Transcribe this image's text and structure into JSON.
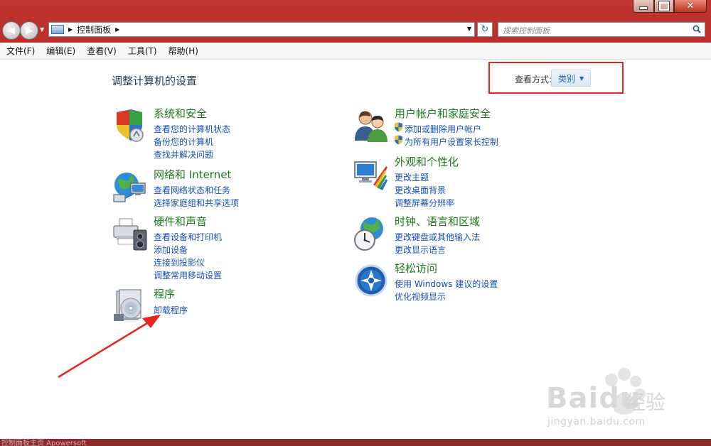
{
  "window": {
    "title_bar_buttons": [
      "minimize-icon",
      "maximize-icon",
      "close-icon"
    ]
  },
  "address": {
    "breadcrumb": "控制面板",
    "search_placeholder": "搜索控制面板"
  },
  "menu": [
    "文件(F)",
    "编辑(E)",
    "查看(V)",
    "工具(T)",
    "帮助(H)"
  ],
  "page": {
    "heading": "调整计算机的设置",
    "view_by_label": "查看方式:",
    "view_by_value": "类别"
  },
  "categories": [
    {
      "title": "系统和安全",
      "icon": "shield-icon",
      "links": [
        "查看您的计算机状态",
        "备份您的计算机",
        "查找并解决问题"
      ]
    },
    {
      "title": "网络和 Internet",
      "icon": "globe-network-icon",
      "links": [
        "查看网络状态和任务",
        "选择家庭组和共享选项"
      ]
    },
    {
      "title": "硬件和声音",
      "icon": "printer-speaker-icon",
      "links": [
        "查看设备和打印机",
        "添加设备",
        "连接到投影仪",
        "调整常用移动设置"
      ]
    },
    {
      "title": "程序",
      "icon": "programs-disc-icon",
      "links": [
        "卸载程序"
      ]
    },
    {
      "title": "用户帐户和家庭安全",
      "icon": "users-icon",
      "links": [
        "添加或删除用户帐户",
        "为所有用户设置家长控制"
      ]
    },
    {
      "title": "外观和个性化",
      "icon": "monitor-palette-icon",
      "links": [
        "更改主题",
        "更改桌面背景",
        "调整屏幕分辨率"
      ]
    },
    {
      "title": "时钟、语言和区域",
      "icon": "clock-globe-icon",
      "links": [
        "更改键盘或其他输入法",
        "更改显示语言"
      ]
    },
    {
      "title": "轻松访问",
      "icon": "ease-of-access-icon",
      "links": [
        "使用 Windows 建议的设置",
        "优化视频显示"
      ]
    }
  ],
  "watermark": {
    "brand": "Bai",
    "brand2": "du",
    "cn": "经验",
    "site": "jingyan.baidu.com"
  },
  "status_text": "控制面板主页 Apowersoft"
}
